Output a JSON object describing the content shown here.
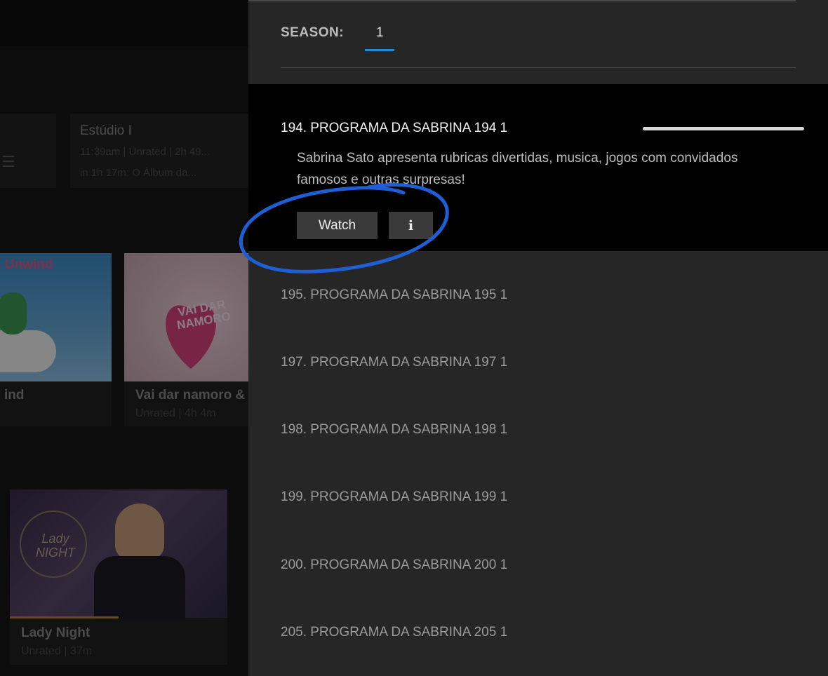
{
  "background": {
    "schedule_tile": {
      "title": "Estúdio I",
      "meta": "11:39am | Unrated | 2h 49...",
      "next": "in 1h 17m: O Álbum da..."
    },
    "cards": [
      {
        "title": "ind",
        "meta": "",
        "thumb_text": "d Unwind"
      },
      {
        "title": "Vai dar namoro &",
        "meta": "Unrated | 4h 4m",
        "thumb_text": "VAI DAR NAMORO"
      },
      {
        "title": "Lady Night",
        "meta": "Unrated | 37m",
        "thumb_text": "Lady NIGHT",
        "progress_fraction": 0.5
      }
    ]
  },
  "panel": {
    "season_label": "SEASON:",
    "season_value": "1",
    "selected_episode": {
      "title": "194. PROGRAMA DA SABRINA 194 1",
      "description": "Sabrina Sato apresenta rubricas divertidas, musica, jogos com convidados famosos e outras surpresas!",
      "progress_fraction": 1.0,
      "watch_label": "Watch",
      "info_label": "i"
    },
    "episodes": [
      "195. PROGRAMA DA SABRINA 195 1",
      "197. PROGRAMA DA SABRINA 197 1",
      "198. PROGRAMA DA SABRINA 198 1",
      "199. PROGRAMA DA SABRINA 199 1",
      "200. PROGRAMA DA SABRINA 200 1",
      "205. PROGRAMA DA SABRINA 205 1"
    ]
  },
  "colors": {
    "accent": "#1e88d8",
    "annotation": "#1f5fd6"
  }
}
